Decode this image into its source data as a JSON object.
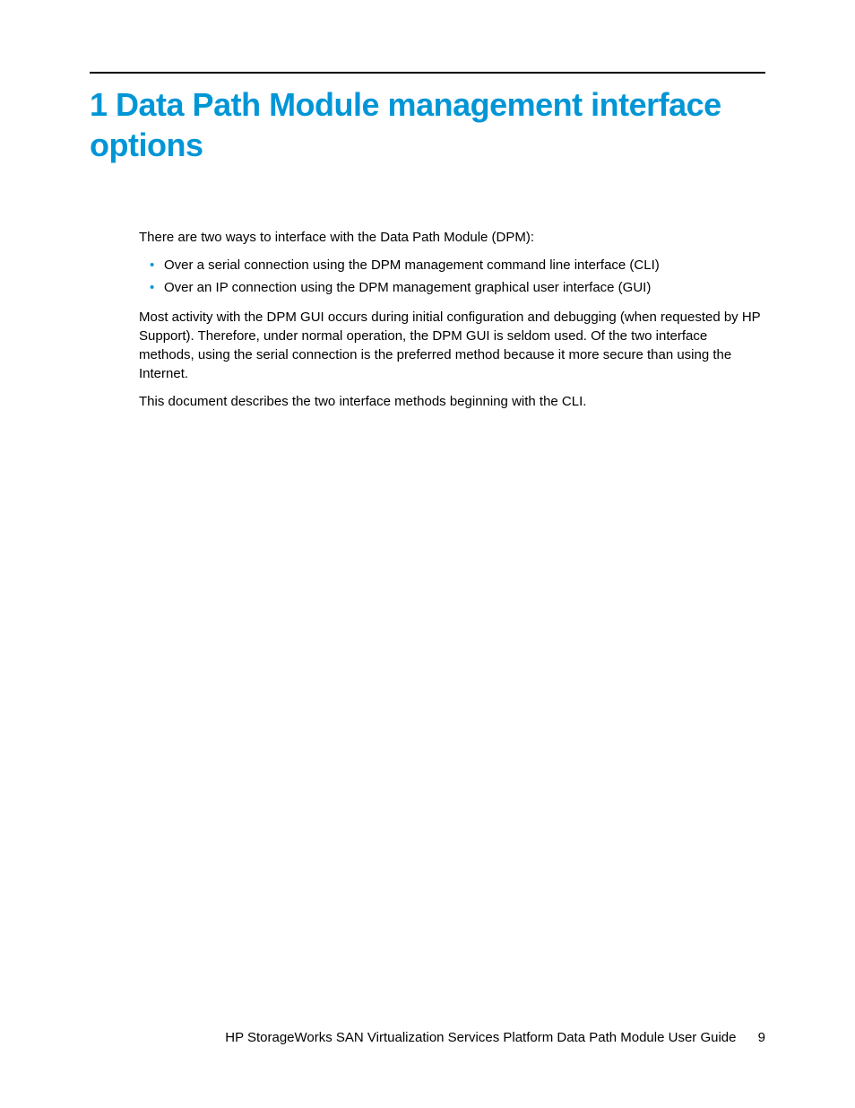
{
  "chapter": {
    "title": "1 Data Path Module management interface options"
  },
  "body": {
    "intro": "There are two ways to interface with the Data Path Module (DPM):",
    "bullets": [
      "Over a serial connection using the DPM management command line interface (CLI)",
      "Over an IP connection using the DPM management graphical user interface (GUI)"
    ],
    "para2": "Most activity with the DPM GUI occurs during initial configuration and debugging (when requested by HP Support). Therefore, under normal operation, the DPM GUI is seldom used. Of the two interface methods, using the serial connection is the preferred method because it more secure than using the Internet.",
    "para3": "This document describes the two interface methods beginning with the CLI."
  },
  "footer": {
    "guide_title": "HP StorageWorks SAN Virtualization Services Platform Data Path Module User Guide",
    "page_number": "9"
  }
}
